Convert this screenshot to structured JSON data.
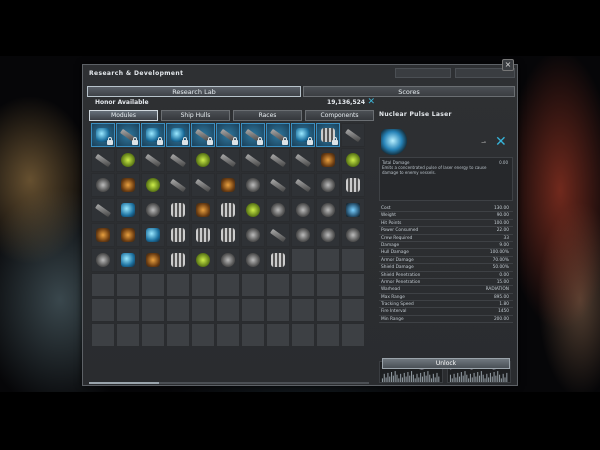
{
  "window": {
    "title": "Research & Development",
    "close_glyph": "×"
  },
  "main_tabs": [
    {
      "label": "Research Lab",
      "active": true
    },
    {
      "label": "Scores",
      "active": false
    }
  ],
  "honor": {
    "label": "Honor Available",
    "value": "19,136,524",
    "clear_glyph": "✕"
  },
  "sub_tabs": [
    {
      "label": "Modules",
      "active": true
    },
    {
      "label": "Ship Hulls",
      "active": false
    },
    {
      "label": "Races",
      "active": false
    },
    {
      "label": "Components",
      "active": false
    }
  ],
  "grid": {
    "columns": 11,
    "rows": 9,
    "items": [
      {
        "icon": "t0",
        "locked": true,
        "hl": true
      },
      {
        "icon": "t1",
        "locked": true,
        "hl": true
      },
      {
        "icon": "t0",
        "locked": true,
        "hl": true
      },
      {
        "icon": "t0",
        "locked": true,
        "hl": true
      },
      {
        "icon": "t1",
        "locked": true,
        "hl": true
      },
      {
        "icon": "t1",
        "locked": true,
        "hl": true
      },
      {
        "icon": "t1",
        "locked": true,
        "hl": true
      },
      {
        "icon": "t1",
        "locked": true,
        "hl": true
      },
      {
        "icon": "t0",
        "locked": true,
        "hl": true
      },
      {
        "icon": "t5",
        "locked": true,
        "hl": true
      },
      {
        "icon": "t1",
        "locked": false,
        "hl": false
      },
      {
        "icon": "t1"
      },
      {
        "icon": "t2"
      },
      {
        "icon": "t1"
      },
      {
        "icon": "t1"
      },
      {
        "icon": "t2"
      },
      {
        "icon": "t1"
      },
      {
        "icon": "t1"
      },
      {
        "icon": "t1"
      },
      {
        "icon": "t1"
      },
      {
        "icon": "t3"
      },
      {
        "icon": "t2"
      },
      {
        "icon": "t4"
      },
      {
        "icon": "t3"
      },
      {
        "icon": "t2"
      },
      {
        "icon": "t1"
      },
      {
        "icon": "t1"
      },
      {
        "icon": "t3"
      },
      {
        "icon": "t4"
      },
      {
        "icon": "t1"
      },
      {
        "icon": "t1"
      },
      {
        "icon": "t4"
      },
      {
        "icon": "t5"
      },
      {
        "icon": "t1"
      },
      {
        "icon": "t0"
      },
      {
        "icon": "t4"
      },
      {
        "icon": "t5"
      },
      {
        "icon": "t3"
      },
      {
        "icon": "t5"
      },
      {
        "icon": "t2"
      },
      {
        "icon": "t4"
      },
      {
        "icon": "t4"
      },
      {
        "icon": "t4"
      },
      {
        "icon": "t6"
      },
      {
        "icon": "t3"
      },
      {
        "icon": "t3"
      },
      {
        "icon": "t0"
      },
      {
        "icon": "t5"
      },
      {
        "icon": "t5"
      },
      {
        "icon": "t5"
      },
      {
        "icon": "t4"
      },
      {
        "icon": "t1"
      },
      {
        "icon": "t4"
      },
      {
        "icon": "t4"
      },
      {
        "icon": "t4"
      },
      {
        "icon": "t4"
      },
      {
        "icon": "t0"
      },
      {
        "icon": "t3"
      },
      {
        "icon": "t5"
      },
      {
        "icon": "t2"
      },
      {
        "icon": "t4"
      },
      {
        "icon": "t4"
      },
      {
        "icon": "t5"
      }
    ]
  },
  "detail": {
    "name": "Nuclear Pulse Laser",
    "preview_small": "⇀",
    "clear_glyph": "✕",
    "total_damage_label": "Total Damage",
    "total_damage_value": "0.00",
    "description": "Emits a concentrated pulse of laser energy to cause damage to enemy vessels.",
    "stats": [
      {
        "label": "Cost",
        "value": "130.00"
      },
      {
        "label": "Weight",
        "value": "90.00"
      },
      {
        "label": "Hit Points",
        "value": "100.00"
      },
      {
        "label": "Power Consumed",
        "value": "22.00"
      },
      {
        "label": "Crew Required",
        "value": "33"
      },
      {
        "label": "Damage",
        "value": "9.00"
      },
      {
        "label": "Hull Damage",
        "value": "100.00%"
      },
      {
        "label": "Armor Damage",
        "value": "70.00%"
      },
      {
        "label": "Shield Damage",
        "value": "50.00%"
      },
      {
        "label": "Shield Penetration",
        "value": "0.00"
      },
      {
        "label": "Armor Penetration",
        "value": "15.00"
      },
      {
        "label": "Warhead",
        "value": "RADIATION"
      },
      {
        "label": "Max Range",
        "value": "895.00"
      },
      {
        "label": "Tracking Speed",
        "value": "1.80"
      },
      {
        "label": "Fire Interval",
        "value": "1450"
      },
      {
        "label": "Min Range",
        "value": "200.00"
      }
    ],
    "unlock_label": "Unlock"
  },
  "colors": {
    "accent": "#3fb6d6",
    "panel": "#2e3033",
    "highlight": "#2f79a0"
  }
}
